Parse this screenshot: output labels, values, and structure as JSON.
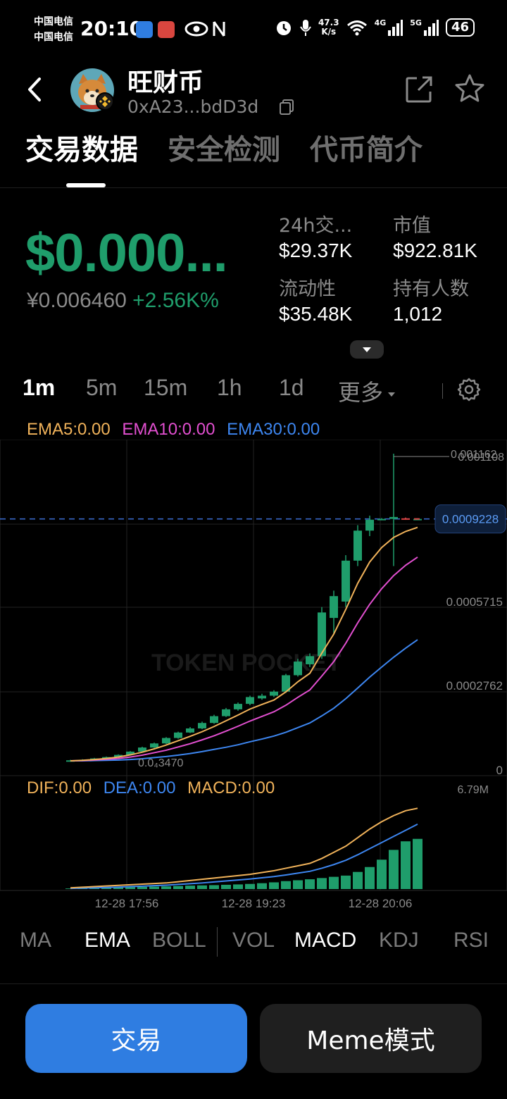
{
  "status_bar": {
    "carrier_1": "中国电信",
    "carrier_2": "中国电信",
    "time": "20:10",
    "net_speed": "47.3",
    "net_unit": "K/s",
    "net_4g": "4G",
    "net_5g": "5G",
    "battery": "46"
  },
  "header": {
    "token_name": "旺财币",
    "token_address": "0xA23...bdD3d"
  },
  "tabs": [
    {
      "label": "交易数据",
      "active": true
    },
    {
      "label": "安全检测",
      "active": false
    },
    {
      "label": "代币简介",
      "active": false
    }
  ],
  "price": {
    "usd": "$0.000...",
    "cny": "¥0.006460",
    "change": "+2.56K%"
  },
  "stats": {
    "volume_label": "24h交...",
    "volume_value": "$29.37K",
    "mcap_label": "市值",
    "mcap_value": "$922.81K",
    "liquidity_label": "流动性",
    "liquidity_value": "$35.48K",
    "holders_label": "持有人数",
    "holders_value": "1,012"
  },
  "intervals": [
    {
      "label": "1m",
      "active": true
    },
    {
      "label": "5m",
      "active": false
    },
    {
      "label": "15m",
      "active": false
    },
    {
      "label": "1h",
      "active": false
    },
    {
      "label": "1d",
      "active": false
    },
    {
      "label": "更多",
      "active": false
    }
  ],
  "ema_legend": {
    "ema5": "EMA5:0.00",
    "ema10": "EMA10:0.00",
    "ema30": "EMA30:0.00"
  },
  "macd_legend": {
    "dif": "DIF:0.00",
    "dea": "DEA:0.00",
    "macd": "MACD:0.00"
  },
  "chart_data": {
    "type": "candlestick",
    "watermark": "TOKEN POCKET",
    "y_ticks": [
      "0.001108",
      "0.0005715",
      "0.0002762",
      "0"
    ],
    "high_label": "0.001162",
    "low_label": "0.0₄3470",
    "current_price_label": "0.0009228",
    "current_price": 0.0009228,
    "ylim": [
      0,
      0.001162
    ],
    "volume_max_label": "6.79M",
    "x_labels": [
      "12-28 17:56",
      "12-28 19:23",
      "12-28 20:06"
    ],
    "candles": [
      [
        3.5e-05,
        3.8e-05,
        4e-05,
        3.3e-05
      ],
      [
        3.8e-05,
        4e-05,
        4.2e-05,
        3.6e-05
      ],
      [
        4e-05,
        4.5e-05,
        4.7e-05,
        3.9e-05
      ],
      [
        4.5e-05,
        5e-05,
        5.2e-05,
        4.4e-05
      ],
      [
        5e-05,
        5.8e-05,
        6e-05,
        4.9e-05
      ],
      [
        5.8e-05,
        7e-05,
        7.2e-05,
        5.6e-05
      ],
      [
        7e-05,
        8.5e-05,
        8.8e-05,
        6.8e-05
      ],
      [
        8.5e-05,
        0.0001,
        0.000103,
        8.3e-05
      ],
      [
        0.0001,
        0.00012,
        0.000123,
        9.8e-05
      ],
      [
        0.00012,
        0.00014,
        0.000143,
        0.000117
      ],
      [
        0.00014,
        0.000155,
        0.00016,
        0.000138
      ],
      [
        0.000155,
        0.000175,
        0.00018,
        0.000152
      ],
      [
        0.000175,
        0.0002,
        0.000205,
        0.000172
      ],
      [
        0.0002,
        0.000225,
        0.00023,
        0.000197
      ],
      [
        0.000225,
        0.000245,
        0.00025,
        0.00022
      ],
      [
        0.000245,
        0.00027,
        0.000275,
        0.00024
      ],
      [
        0.000265,
        0.000275,
        0.000282,
        0.00026
      ],
      [
        0.000275,
        0.00029,
        0.000295,
        0.00027
      ],
      [
        0.00029,
        0.00035,
        0.000355,
        0.000285
      ],
      [
        0.00035,
        0.0004,
        0.00041,
        0.000345
      ],
      [
        0.00039,
        0.00042,
        0.00043,
        0.00038
      ],
      [
        0.00042,
        0.00058,
        0.0006,
        0.00041
      ],
      [
        0.00056,
        0.00064,
        0.00066,
        0.0005
      ],
      [
        0.00062,
        0.00077,
        0.00079,
        0.0006
      ],
      [
        0.00077,
        0.00088,
        0.0009,
        0.00075
      ],
      [
        0.00088,
        0.00092,
        0.000935,
        0.00086
      ],
      [
        0.00092,
        0.000923,
        0.000926,
        0.000918
      ],
      [
        0.000923,
        0.00093,
        0.001162,
        0.00075
      ],
      [
        0.000925,
        0.000922,
        0.000928,
        0.00092
      ],
      [
        0.000922,
        0.000923,
        0.000925,
        0.00092
      ]
    ],
    "ema5": [
      3.6e-05,
      3.8e-05,
      4.1e-05,
      4.5e-05,
      5e-05,
      5.8e-05,
      6.8e-05,
      8e-05,
      9.4e-05,
      0.00011,
      0.000126,
      0.000143,
      0.000162,
      0.000183,
      0.000204,
      0.000226,
      0.000243,
      0.000259,
      0.000289,
      0.000326,
      0.000357,
      0.000431,
      0.000501,
      0.000591,
      0.000687,
      0.000765,
      0.000818,
      0.000855,
      0.000877,
      0.000892
    ],
    "ema10": [
      3.6e-05,
      3.7e-05,
      3.9e-05,
      4.2e-05,
      4.5e-05,
      5e-05,
      5.7e-05,
      6.6e-05,
      7.5e-05,
      8.7e-05,
      9.9e-05,
      0.000113,
      0.000128,
      0.000145,
      0.000163,
      0.000182,
      0.000199,
      0.000216,
      0.00024,
      0.000269,
      0.000296,
      0.000347,
      0.0004,
      0.000467,
      0.000542,
      0.00061,
      0.000667,
      0.000715,
      0.000753,
      0.000783
    ],
    "ema30": [
      3.6e-05,
      3.6e-05,
      3.7e-05,
      3.8e-05,
      3.9e-05,
      4.1e-05,
      4.4e-05,
      4.8e-05,
      5.2e-05,
      5.7e-05,
      6.3e-05,
      7e-05,
      7.8e-05,
      8.6e-05,
      9.5e-05,
      0.000106,
      0.000116,
      0.000127,
      0.000141,
      0.000158,
      0.000175,
      0.000201,
      0.000229,
      0.000264,
      0.000303,
      0.000343,
      0.00038,
      0.000416,
      0.000449,
      0.00048
    ],
    "volume_bars": [
      0.05,
      0.08,
      0.1,
      0.12,
      0.14,
      0.16,
      0.18,
      0.2,
      0.22,
      0.25,
      0.28,
      0.3,
      0.32,
      0.35,
      0.38,
      0.42,
      0.48,
      0.55,
      0.65,
      0.72,
      0.8,
      0.9,
      1.0,
      1.1,
      1.4,
      1.8,
      2.4,
      3.2,
      3.9,
      4.1
    ],
    "dif": [
      0.1,
      0.15,
      0.2,
      0.25,
      0.3,
      0.35,
      0.4,
      0.45,
      0.5,
      0.6,
      0.7,
      0.8,
      0.9,
      1.0,
      1.1,
      1.2,
      1.35,
      1.5,
      1.7,
      1.9,
      2.1,
      2.5,
      3.0,
      3.5,
      4.2,
      4.9,
      5.5,
      6.0,
      6.4,
      6.6
    ],
    "dea": [
      0.05,
      0.08,
      0.1,
      0.13,
      0.16,
      0.2,
      0.24,
      0.28,
      0.32,
      0.38,
      0.44,
      0.5,
      0.58,
      0.66,
      0.74,
      0.82,
      0.92,
      1.02,
      1.15,
      1.3,
      1.45,
      1.7,
      2.0,
      2.35,
      2.8,
      3.3,
      3.8,
      4.3,
      4.8,
      5.3
    ]
  },
  "indicators": [
    {
      "label": "MA",
      "active": false
    },
    {
      "label": "EMA",
      "active": true
    },
    {
      "label": "BOLL",
      "active": false
    },
    {
      "label": "VOL",
      "active": false
    },
    {
      "label": "MACD",
      "active": true
    },
    {
      "label": "KDJ",
      "active": false
    },
    {
      "label": "RSI",
      "active": false
    }
  ],
  "buttons": {
    "trade": "交易",
    "meme": "Meme模式"
  },
  "colors": {
    "up": "#1f9d6b",
    "accent": "#2f7de1",
    "ema5": "#f0b25a",
    "ema10": "#e24fd0",
    "ema30": "#3d86f0"
  }
}
